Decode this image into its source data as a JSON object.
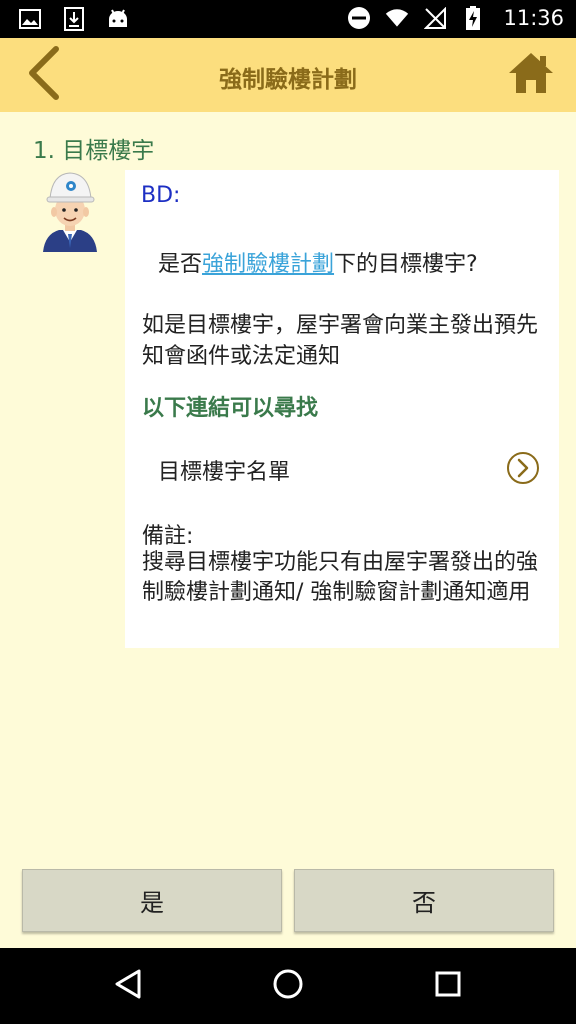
{
  "status_bar": {
    "time": "11:36",
    "icons_left": [
      "image-icon",
      "download-icon",
      "android-icon"
    ],
    "icons_right": [
      "do-not-disturb-icon",
      "wifi-icon",
      "no-sim-icon",
      "battery-charging-icon"
    ]
  },
  "header": {
    "title": "強制驗樓計劃",
    "background": "#fcde7e",
    "back_icon": "chevron-left-icon",
    "home_icon": "home-icon"
  },
  "content": {
    "question_label": "1. 目標樓宇",
    "speaker": "BD:",
    "question_prefix": "是否",
    "question_link": "強制驗樓計劃",
    "question_suffix": "下的目標樓宇?",
    "info_text": "如是目標樓宇，屋宇署會向業主發出預先知會函件或法定通知",
    "links_heading": "以下連結可以尋找",
    "list_link_label": "目標樓宇名單",
    "remark_title": "備註:",
    "remark_body": "搜尋目標樓宇功能只有由屋宇署發出的強制驗樓計劃通知/ 強制驗窗計劃通知適用"
  },
  "buttons": {
    "yes": "是",
    "no": "否"
  },
  "colors": {
    "page_background": "#fefbd8",
    "title_text": "#8a6b1a",
    "green_text": "#3a7a4b",
    "link": "#3aa3d9",
    "speaker": "#1d2fc3"
  }
}
